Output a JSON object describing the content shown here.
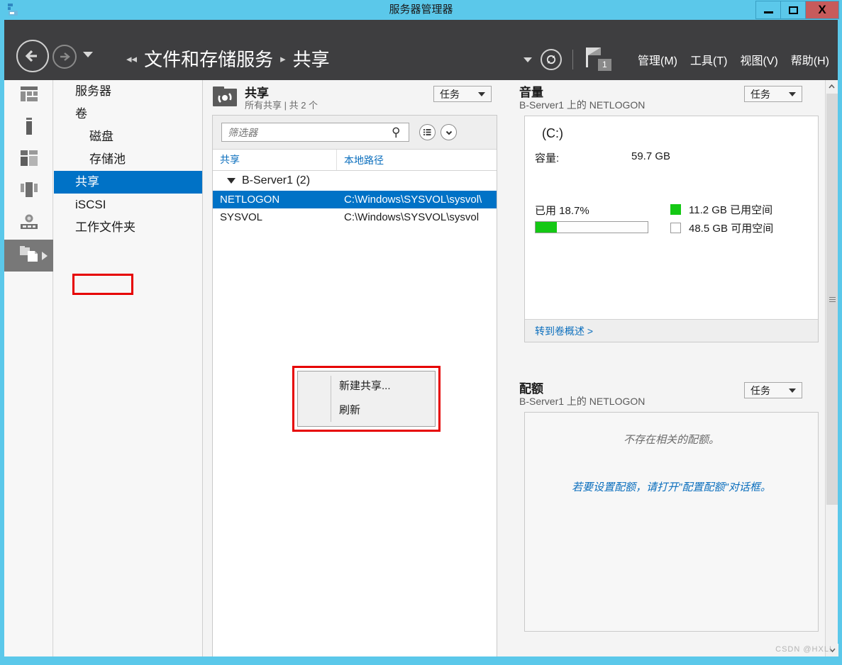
{
  "window": {
    "title": "服务器管理器",
    "app_icon": "server-manager-icon",
    "minimize_label": "",
    "maximize_label": "",
    "close_label": "X",
    "accent_color": "#5bc8ea",
    "close_color": "#c75b5b",
    "navbar_color": "#3e3e40",
    "selection_color": "#0072c6",
    "highlight_color": "#e60000"
  },
  "navbar": {
    "back_icon": "back-arrow-icon",
    "forward_icon": "forward-arrow-icon",
    "dropdown_icon": "chevron-down-icon",
    "breadcrumb_back": "◂◂",
    "breadcrumb_root": "文件和存储服务",
    "breadcrumb_sep": "▸",
    "breadcrumb_current": "共享",
    "refresh_icon": "refresh-icon",
    "flag_icon": "notification-flag-icon",
    "flag_badge": "1",
    "menus": [
      {
        "label": "管理(M)"
      },
      {
        "label": "工具(T)"
      },
      {
        "label": "视图(V)"
      },
      {
        "label": "帮助(H)"
      }
    ]
  },
  "rail": {
    "items": [
      {
        "name": "dashboard-icon",
        "selected": false
      },
      {
        "name": "server-icon",
        "selected": false
      },
      {
        "name": "volumes-icon",
        "selected": false
      },
      {
        "name": "disks-icon",
        "selected": false
      },
      {
        "name": "storage-pool-icon",
        "selected": false
      },
      {
        "name": "shares-icon",
        "selected": true
      }
    ]
  },
  "tree": {
    "items": [
      {
        "label": "服务器",
        "indent": false,
        "selected": false
      },
      {
        "label": "卷",
        "indent": false,
        "selected": false
      },
      {
        "label": "磁盘",
        "indent": true,
        "selected": false
      },
      {
        "label": "存储池",
        "indent": true,
        "selected": false
      },
      {
        "label": "共享",
        "indent": false,
        "selected": true
      },
      {
        "label": "iSCSI",
        "indent": false,
        "selected": false
      },
      {
        "label": "工作文件夹",
        "indent": false,
        "selected": false
      }
    ]
  },
  "shares_pane": {
    "icon": "shares-folder-icon",
    "title": "共享",
    "subtitle": "所有共享 | 共 2 个",
    "tasks_label": "任务",
    "filter_placeholder": "筛选器",
    "search_icon": "search-icon",
    "view_icon": "list-view-icon",
    "expand_icon": "chevron-down-icon",
    "columns": [
      "共享",
      "本地路径"
    ],
    "group": {
      "label": "B-Server1 (2)",
      "expanded": true
    },
    "rows": [
      {
        "share": "NETLOGON",
        "path": "C:\\Windows\\SYSVOL\\sysvol\\",
        "selected": true
      },
      {
        "share": "SYSVOL",
        "path": "C:\\Windows\\SYSVOL\\sysvol",
        "selected": false
      }
    ]
  },
  "context_menu": {
    "items": [
      {
        "label": "新建共享..."
      },
      {
        "label": "刷新"
      }
    ]
  },
  "volume_card": {
    "title": "音量",
    "subtitle": "B-Server1 上的 NETLOGON",
    "tasks_label": "任务",
    "drive": "(C:)",
    "capacity_label": "容量:",
    "capacity_value": "59.7 GB",
    "used_percent_label": "已用 18.7%",
    "used_percent": 18.7,
    "legend_used": "11.2 GB 已用空间",
    "legend_free": "48.5 GB 可用空间",
    "used_color": "#14c814",
    "footer_link": "转到卷概述 >"
  },
  "quota_card": {
    "title": "配额",
    "subtitle": "B-Server1 上的 NETLOGON",
    "tasks_label": "任务",
    "empty_message": "不存在相关的配额。",
    "hint_link": "若要设置配额，请打开\"配置配额\"对话框。"
  },
  "scrollbar": {
    "up_icon": "chevron-up-icon",
    "down_icon": "chevron-down-icon"
  },
  "watermark": "CSDN @HXL!"
}
